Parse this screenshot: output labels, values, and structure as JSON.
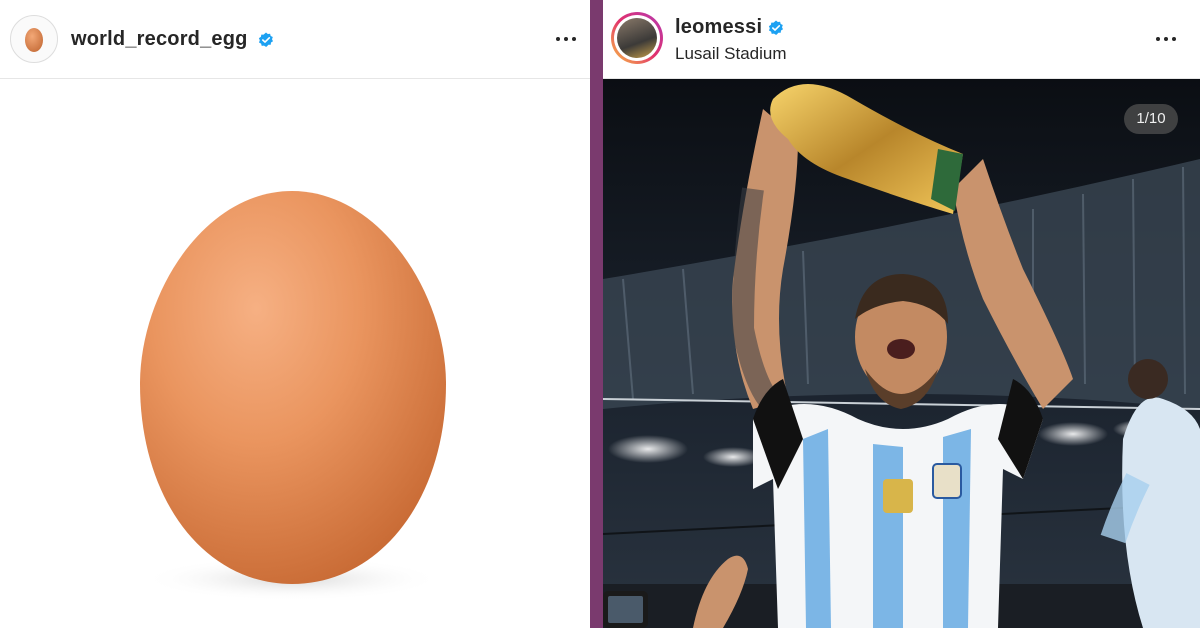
{
  "left_post": {
    "username": "world_record_egg",
    "verified_icon": "verified-badge-icon",
    "more_icon": "more-options-icon"
  },
  "right_post": {
    "username": "leomessi",
    "location": "Lusail Stadium",
    "verified_icon": "verified-badge-icon",
    "more_icon": "more-options-icon",
    "carousel_counter": "1/10"
  },
  "colors": {
    "divider": "#7a3a6e",
    "verified_badge": "#1da1f2",
    "egg": "#e8915a"
  }
}
